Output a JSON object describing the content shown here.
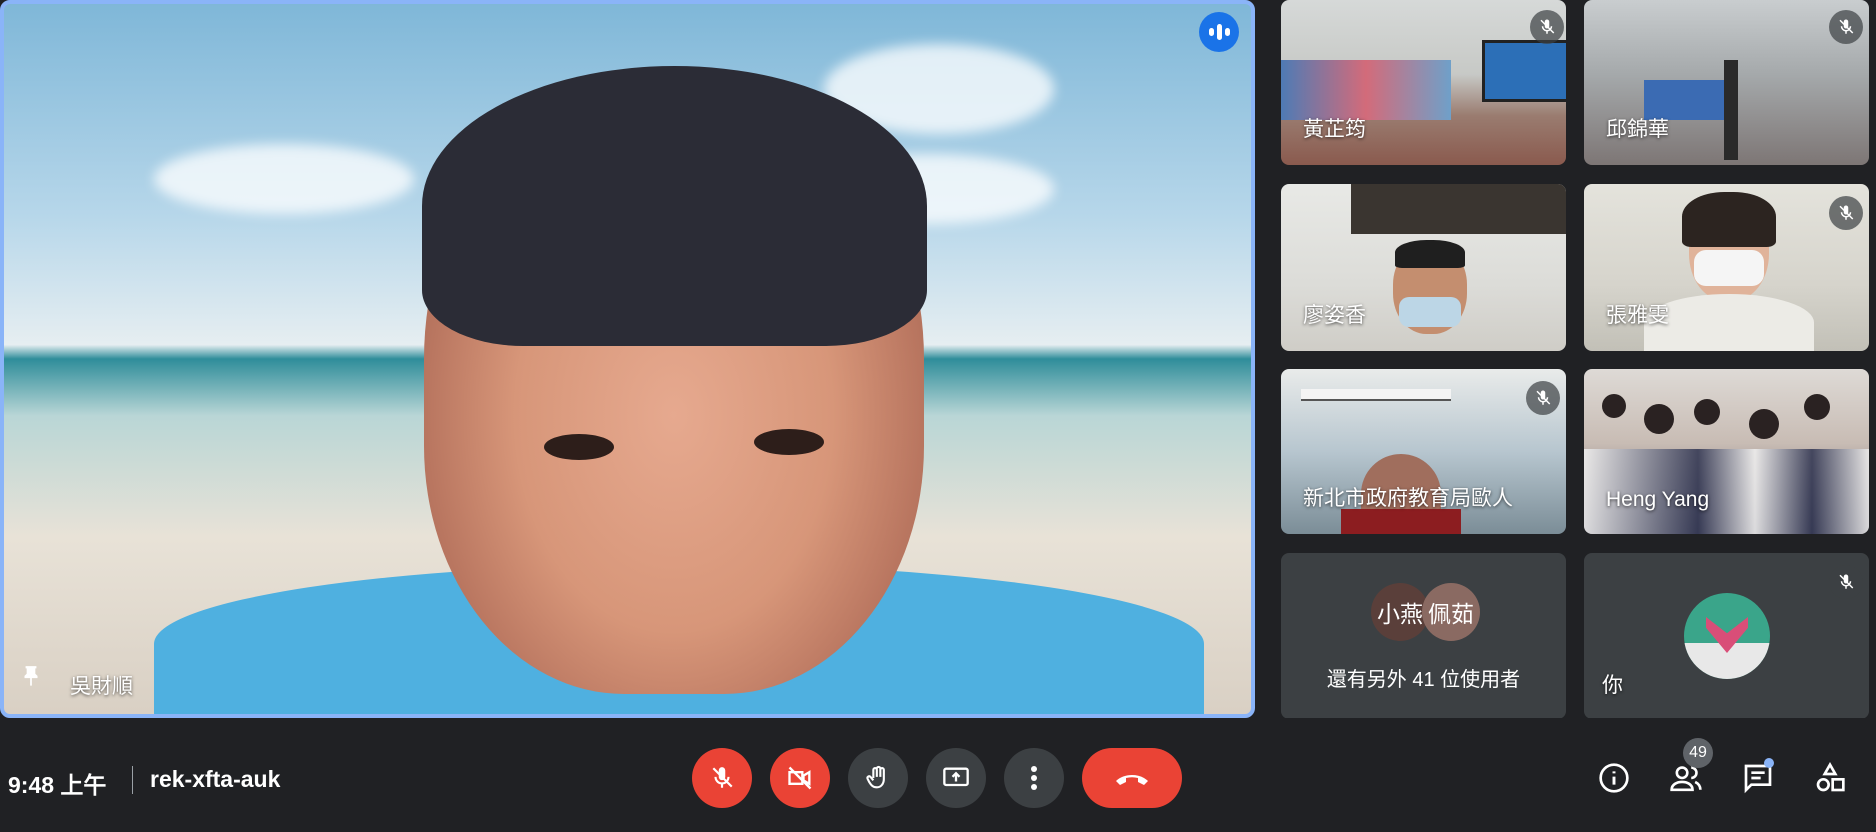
{
  "main_speaker": {
    "name": "吳財順"
  },
  "participants": [
    {
      "name": "黃芷筠"
    },
    {
      "name": "邱錦華"
    },
    {
      "name": "廖姿香"
    },
    {
      "name": "張雅雯"
    },
    {
      "name": "新北市政府教育局歐人"
    },
    {
      "name": "Heng Yang"
    }
  ],
  "others_tile": {
    "avatars": [
      "小燕",
      "佩茹"
    ],
    "text": "還有另外 41 位使用者"
  },
  "self_tile": {
    "name": "你"
  },
  "bottom_bar": {
    "time": "9:48 上午",
    "meeting_code": "rek-xfta-auk",
    "participant_count": "49"
  },
  "colors": {
    "accent": "#8ab4f8",
    "danger": "#ea4335",
    "speaking": "#1a73e8",
    "background": "#202124",
    "tile": "#3c4043"
  },
  "icons": {
    "mic_toggle": "mic-off-icon",
    "camera_toggle": "camera-off-icon",
    "raise_hand": "hand-icon",
    "present": "present-screen-icon",
    "more": "more-vert-icon",
    "leave": "call-end-icon",
    "info": "info-icon",
    "people": "people-icon",
    "chat": "chat-icon",
    "activities": "activities-icon"
  }
}
